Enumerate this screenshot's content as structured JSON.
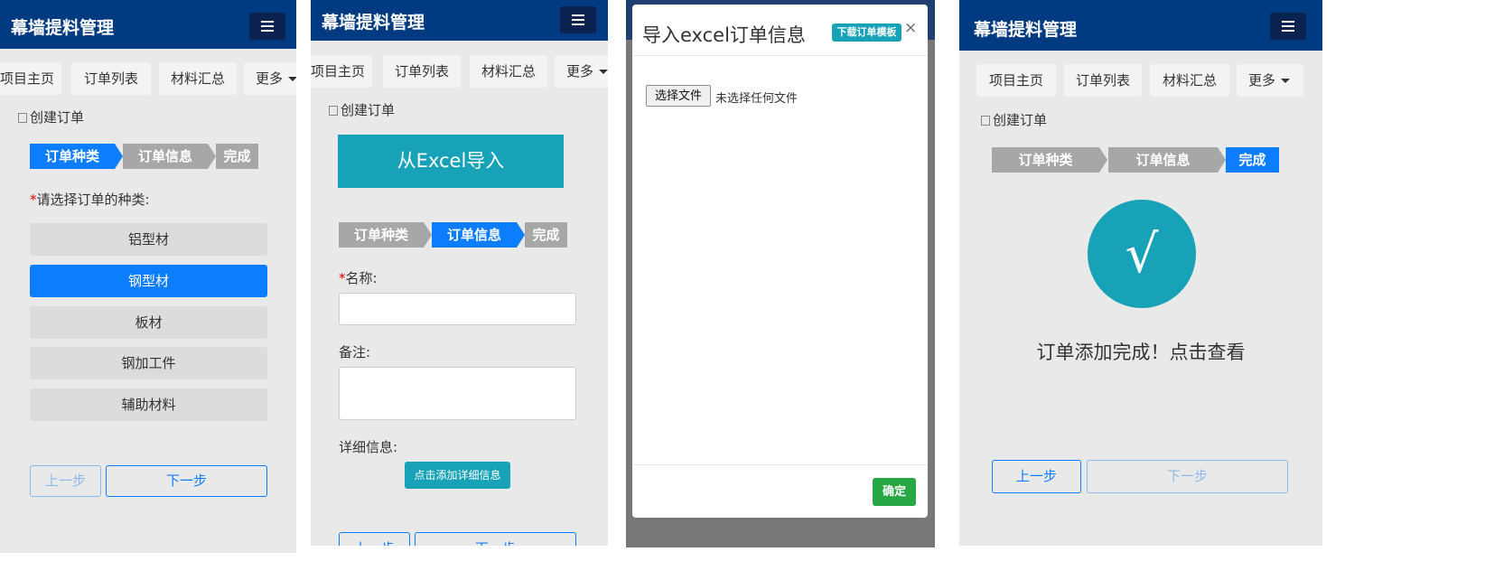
{
  "app_title": "幕墙提料管理",
  "nav": {
    "home": "项目主页",
    "orders": "订单列表",
    "materials": "材料汇总",
    "more": "更多"
  },
  "section_title": "创建订单",
  "steps": [
    "订单种类",
    "订单信息",
    "完成"
  ],
  "panel1": {
    "prompt_required": "*",
    "prompt": "请选择订单的种类:",
    "options": [
      "铝型材",
      "钢型材",
      "板材",
      "钢加工件",
      "辅助材料"
    ],
    "selected_option": "钢型材",
    "prev": "上一步",
    "next": "下一步"
  },
  "panel2": {
    "excel_button": "从Excel导入",
    "name_required": "*",
    "name_label": "名称:",
    "note_label": "备注:",
    "detail_label": "详细信息:",
    "add_detail_button": "点击添加详细信息",
    "prev": "上一步",
    "next": "下一步"
  },
  "modal": {
    "title": "导入excel订单信息",
    "download_template": "下载订单模板",
    "close": "×",
    "choose_file": "选择文件",
    "no_file": "未选择任何文件",
    "confirm": "确定"
  },
  "panel4": {
    "check_mark": "√",
    "done_text": "订单添加完成！点击查看",
    "prev": "上一步",
    "next": "下一步"
  },
  "colors": {
    "header": "#003a80",
    "primary": "#0d7dff",
    "step_grey": "#a7a7a7",
    "teal": "#17a2b8",
    "success": "#28a745"
  }
}
